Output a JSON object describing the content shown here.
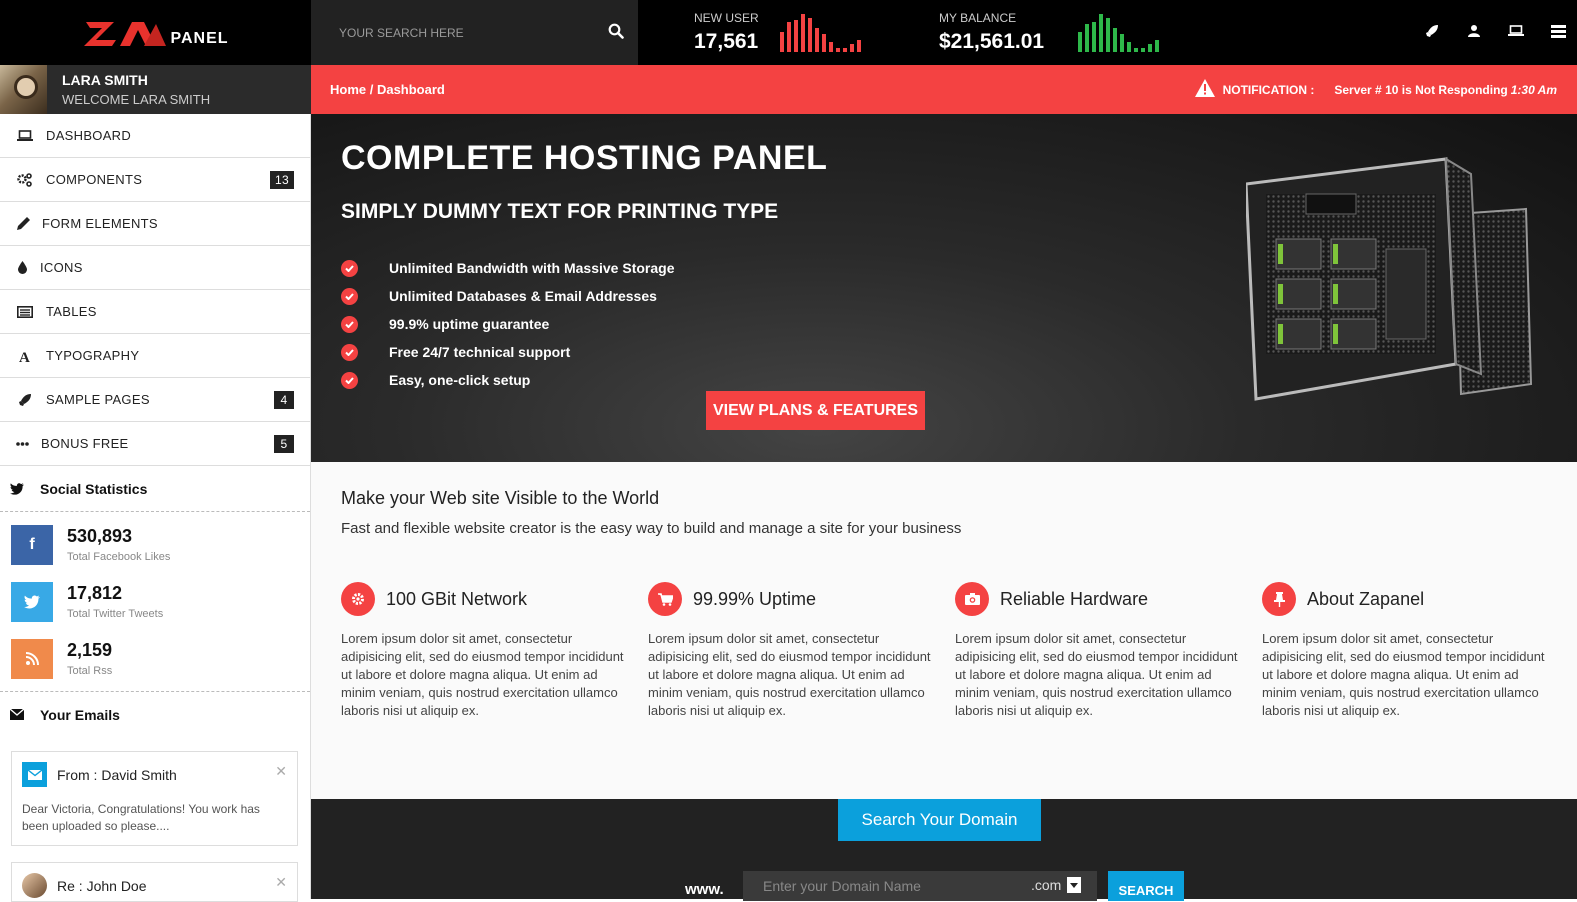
{
  "brand": {
    "logo_text": "PANEL",
    "logo_mark": "ZA"
  },
  "search": {
    "placeholder": "YOUR SEARCH HERE",
    "icon": "search-icon"
  },
  "stats": [
    {
      "label": "NEW USER",
      "value": "17,561",
      "color": "#f44242",
      "bars": [
        0.5,
        0.75,
        0.8,
        0.95,
        0.85,
        0.6,
        0.45,
        0.25,
        0.1,
        0.1,
        0.2,
        0.3
      ]
    },
    {
      "label": "MY BALANCE",
      "value": "$21,561.01",
      "color": "#2eb84a",
      "bars": [
        0.5,
        0.7,
        0.75,
        0.95,
        0.85,
        0.6,
        0.45,
        0.25,
        0.1,
        0.1,
        0.2,
        0.3
      ]
    }
  ],
  "top_icons": [
    "rocket-icon",
    "user-icon",
    "laptop-icon",
    "list-icon"
  ],
  "user": {
    "name": "LARA SMITH",
    "welcome": "WELCOME LARA SMITH"
  },
  "breadcrumb": "Home / Dashboard",
  "notification": {
    "label": "NOTIFICATION :",
    "message": "Server # 10 is Not Responding",
    "time": "1:30 Am"
  },
  "nav": [
    {
      "label": "DASHBOARD",
      "icon": "laptop-icon"
    },
    {
      "label": "COMPONENTS",
      "icon": "cogs-icon",
      "badge": "13"
    },
    {
      "label": "FORM ELEMENTS",
      "icon": "pencil-icon"
    },
    {
      "label": "ICONS",
      "icon": "drop-icon"
    },
    {
      "label": "TABLES",
      "icon": "table-icon"
    },
    {
      "label": "TYPOGRAPHY",
      "icon": "font-icon"
    },
    {
      "label": "SAMPLE PAGES",
      "icon": "rocket-icon",
      "badge": "4"
    },
    {
      "label": "BONUS FREE",
      "icon": "ellipsis-icon",
      "badge": "5"
    }
  ],
  "social": {
    "title": "Social Statistics",
    "items": [
      {
        "value": "530,893",
        "label": "Total Facebook Likes",
        "color": "#3b65a7",
        "icon": "facebook-icon"
      },
      {
        "value": "17,812",
        "label": "Total Twitter Tweets",
        "color": "#38a9e6",
        "icon": "twitter-icon"
      },
      {
        "value": "2,159",
        "label": "Total Rss",
        "color": "#f08a4b",
        "icon": "rss-icon"
      }
    ]
  },
  "emails": {
    "title": "Your Emails",
    "items": [
      {
        "from": "From : David Smith",
        "body": "Dear Victoria, Congratulations! You work has been uploaded so please...."
      },
      {
        "from": "Re : John Doe",
        "body": ""
      }
    ]
  },
  "hero": {
    "title": "COMPLETE HOSTING PANEL",
    "subtitle": "SIMPLY DUMMY TEXT FOR PRINTING TYPE",
    "features": [
      "Unlimited Bandwidth with Massive Storage",
      "Unlimited Databases & Email Addresses",
      "99.9% uptime guarantee",
      "Free 24/7 technical support",
      "Easy, one-click setup"
    ],
    "button": "VIEW PLANS & FEATURES"
  },
  "content": {
    "title": "Make your Web site Visible to the World",
    "subtitle": "Fast and flexible website creator is the easy way to build and manage a site for your business",
    "columns": [
      {
        "title": "100 GBit Network",
        "icon": "gear-icon",
        "text": "Lorem ipsum dolor sit amet, consectetur adipisicing elit, sed do eiusmod tempor incididunt ut labore et dolore magna aliqua. Ut enim ad minim veniam, quis nostrud exercitation ullamco laboris nisi ut aliquip ex."
      },
      {
        "title": "99.99% Uptime",
        "icon": "cart-icon",
        "text": "Lorem ipsum dolor sit amet, consectetur adipisicing elit, sed do eiusmod tempor incididunt ut labore et dolore magna aliqua. Ut enim ad minim veniam, quis nostrud exercitation ullamco laboris nisi ut aliquip ex."
      },
      {
        "title": "Reliable Hardware",
        "icon": "camera-icon",
        "text": "Lorem ipsum dolor sit amet, consectetur adipisicing elit, sed do eiusmod tempor incididunt ut labore et dolore magna aliqua. Ut enim ad minim veniam, quis nostrud exercitation ullamco laboris nisi ut aliquip ex."
      },
      {
        "title": "About Zapanel",
        "icon": "pin-icon",
        "text": "Lorem ipsum dolor sit amet, consectetur adipisicing elit, sed do eiusmod tempor incididunt ut labore et dolore magna aliqua. Ut enim ad minim veniam, quis nostrud exercitation ullamco laboris nisi ut aliquip ex."
      }
    ]
  },
  "domain": {
    "tab": "Search Your Domain",
    "prefix": "www.",
    "placeholder": "Enter your Domain Name",
    "tld": ".com",
    "button": "SEARCH"
  },
  "colors": {
    "accent": "#f44242",
    "blue": "#0ba0dc",
    "dark": "#222222"
  }
}
